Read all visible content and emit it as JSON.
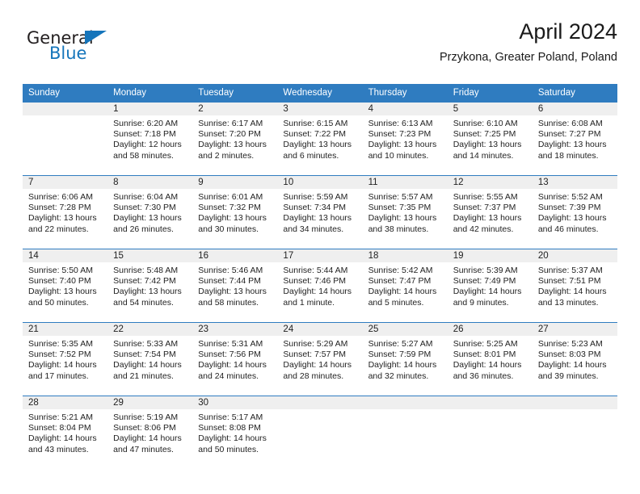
{
  "brand": {
    "name_dark": "General",
    "name_blue": "Blue",
    "triangle_color": "#1575bb"
  },
  "header": {
    "title": "April 2024",
    "subtitle": "Przykona, Greater Poland, Poland"
  },
  "colors": {
    "header_blue": "#2f7cc0",
    "band_gray": "#efefef",
    "text": "#222222"
  },
  "weekday_headers": [
    "Sunday",
    "Monday",
    "Tuesday",
    "Wednesday",
    "Thursday",
    "Friday",
    "Saturday"
  ],
  "weeks": [
    [
      {
        "day": "",
        "empty": true,
        "sunrise": "",
        "sunset": "",
        "daylight": ""
      },
      {
        "day": "1",
        "sunrise": "Sunrise: 6:20 AM",
        "sunset": "Sunset: 7:18 PM",
        "daylight": "Daylight: 12 hours and 58 minutes."
      },
      {
        "day": "2",
        "sunrise": "Sunrise: 6:17 AM",
        "sunset": "Sunset: 7:20 PM",
        "daylight": "Daylight: 13 hours and 2 minutes."
      },
      {
        "day": "3",
        "sunrise": "Sunrise: 6:15 AM",
        "sunset": "Sunset: 7:22 PM",
        "daylight": "Daylight: 13 hours and 6 minutes."
      },
      {
        "day": "4",
        "sunrise": "Sunrise: 6:13 AM",
        "sunset": "Sunset: 7:23 PM",
        "daylight": "Daylight: 13 hours and 10 minutes."
      },
      {
        "day": "5",
        "sunrise": "Sunrise: 6:10 AM",
        "sunset": "Sunset: 7:25 PM",
        "daylight": "Daylight: 13 hours and 14 minutes."
      },
      {
        "day": "6",
        "sunrise": "Sunrise: 6:08 AM",
        "sunset": "Sunset: 7:27 PM",
        "daylight": "Daylight: 13 hours and 18 minutes."
      }
    ],
    [
      {
        "day": "7",
        "sunrise": "Sunrise: 6:06 AM",
        "sunset": "Sunset: 7:28 PM",
        "daylight": "Daylight: 13 hours and 22 minutes."
      },
      {
        "day": "8",
        "sunrise": "Sunrise: 6:04 AM",
        "sunset": "Sunset: 7:30 PM",
        "daylight": "Daylight: 13 hours and 26 minutes."
      },
      {
        "day": "9",
        "sunrise": "Sunrise: 6:01 AM",
        "sunset": "Sunset: 7:32 PM",
        "daylight": "Daylight: 13 hours and 30 minutes."
      },
      {
        "day": "10",
        "sunrise": "Sunrise: 5:59 AM",
        "sunset": "Sunset: 7:34 PM",
        "daylight": "Daylight: 13 hours and 34 minutes."
      },
      {
        "day": "11",
        "sunrise": "Sunrise: 5:57 AM",
        "sunset": "Sunset: 7:35 PM",
        "daylight": "Daylight: 13 hours and 38 minutes."
      },
      {
        "day": "12",
        "sunrise": "Sunrise: 5:55 AM",
        "sunset": "Sunset: 7:37 PM",
        "daylight": "Daylight: 13 hours and 42 minutes."
      },
      {
        "day": "13",
        "sunrise": "Sunrise: 5:52 AM",
        "sunset": "Sunset: 7:39 PM",
        "daylight": "Daylight: 13 hours and 46 minutes."
      }
    ],
    [
      {
        "day": "14",
        "sunrise": "Sunrise: 5:50 AM",
        "sunset": "Sunset: 7:40 PM",
        "daylight": "Daylight: 13 hours and 50 minutes."
      },
      {
        "day": "15",
        "sunrise": "Sunrise: 5:48 AM",
        "sunset": "Sunset: 7:42 PM",
        "daylight": "Daylight: 13 hours and 54 minutes."
      },
      {
        "day": "16",
        "sunrise": "Sunrise: 5:46 AM",
        "sunset": "Sunset: 7:44 PM",
        "daylight": "Daylight: 13 hours and 58 minutes."
      },
      {
        "day": "17",
        "sunrise": "Sunrise: 5:44 AM",
        "sunset": "Sunset: 7:46 PM",
        "daylight": "Daylight: 14 hours and 1 minute."
      },
      {
        "day": "18",
        "sunrise": "Sunrise: 5:42 AM",
        "sunset": "Sunset: 7:47 PM",
        "daylight": "Daylight: 14 hours and 5 minutes."
      },
      {
        "day": "19",
        "sunrise": "Sunrise: 5:39 AM",
        "sunset": "Sunset: 7:49 PM",
        "daylight": "Daylight: 14 hours and 9 minutes."
      },
      {
        "day": "20",
        "sunrise": "Sunrise: 5:37 AM",
        "sunset": "Sunset: 7:51 PM",
        "daylight": "Daylight: 14 hours and 13 minutes."
      }
    ],
    [
      {
        "day": "21",
        "sunrise": "Sunrise: 5:35 AM",
        "sunset": "Sunset: 7:52 PM",
        "daylight": "Daylight: 14 hours and 17 minutes."
      },
      {
        "day": "22",
        "sunrise": "Sunrise: 5:33 AM",
        "sunset": "Sunset: 7:54 PM",
        "daylight": "Daylight: 14 hours and 21 minutes."
      },
      {
        "day": "23",
        "sunrise": "Sunrise: 5:31 AM",
        "sunset": "Sunset: 7:56 PM",
        "daylight": "Daylight: 14 hours and 24 minutes."
      },
      {
        "day": "24",
        "sunrise": "Sunrise: 5:29 AM",
        "sunset": "Sunset: 7:57 PM",
        "daylight": "Daylight: 14 hours and 28 minutes."
      },
      {
        "day": "25",
        "sunrise": "Sunrise: 5:27 AM",
        "sunset": "Sunset: 7:59 PM",
        "daylight": "Daylight: 14 hours and 32 minutes."
      },
      {
        "day": "26",
        "sunrise": "Sunrise: 5:25 AM",
        "sunset": "Sunset: 8:01 PM",
        "daylight": "Daylight: 14 hours and 36 minutes."
      },
      {
        "day": "27",
        "sunrise": "Sunrise: 5:23 AM",
        "sunset": "Sunset: 8:03 PM",
        "daylight": "Daylight: 14 hours and 39 minutes."
      }
    ],
    [
      {
        "day": "28",
        "sunrise": "Sunrise: 5:21 AM",
        "sunset": "Sunset: 8:04 PM",
        "daylight": "Daylight: 14 hours and 43 minutes."
      },
      {
        "day": "29",
        "sunrise": "Sunrise: 5:19 AM",
        "sunset": "Sunset: 8:06 PM",
        "daylight": "Daylight: 14 hours and 47 minutes."
      },
      {
        "day": "30",
        "sunrise": "Sunrise: 5:17 AM",
        "sunset": "Sunset: 8:08 PM",
        "daylight": "Daylight: 14 hours and 50 minutes."
      },
      {
        "day": "",
        "empty": true,
        "sunrise": "",
        "sunset": "",
        "daylight": ""
      },
      {
        "day": "",
        "empty": true,
        "sunrise": "",
        "sunset": "",
        "daylight": ""
      },
      {
        "day": "",
        "empty": true,
        "sunrise": "",
        "sunset": "",
        "daylight": ""
      },
      {
        "day": "",
        "empty": true,
        "sunrise": "",
        "sunset": "",
        "daylight": ""
      }
    ]
  ]
}
